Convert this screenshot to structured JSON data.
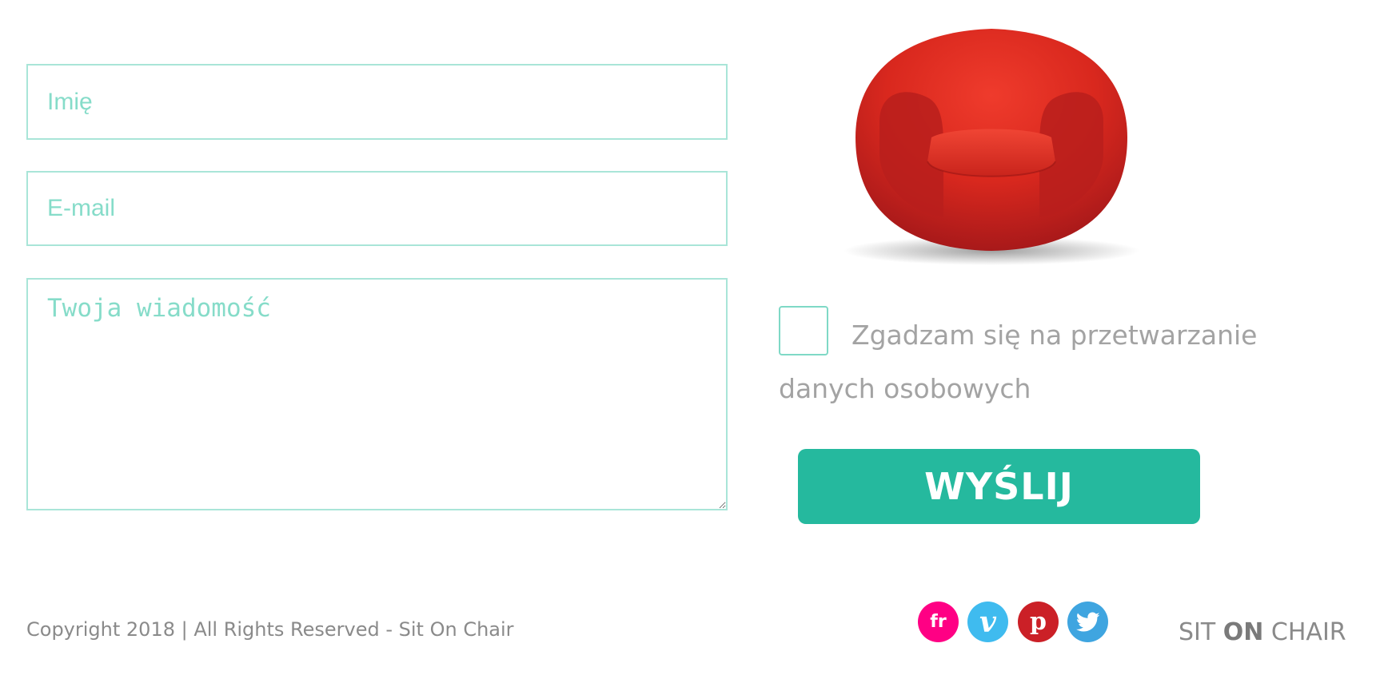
{
  "form": {
    "name_placeholder": "Imię",
    "email_placeholder": "E-mail",
    "message_placeholder": "Twoja wiadomość",
    "consent_label": "Zgadzam się na przetwarzanie danych osobowych",
    "consent_checked": false,
    "send_label": "WYŚLIJ"
  },
  "footer": {
    "copyright": "Copyright 2018 | All Rights Reserved - Sit On Chair",
    "logo_part1": "SIT ",
    "logo_part2": "ON",
    "logo_part3": " CHAIR"
  },
  "social": {
    "flickr": "fr",
    "vimeo": "v",
    "pinterest": "p"
  },
  "icons": [
    "chair-image",
    "flickr-icon",
    "vimeo-icon",
    "pinterest-icon",
    "twitter-icon"
  ],
  "colors": {
    "accent": "#25b99e",
    "field_border": "#a9e5d8",
    "placeholder": "#86dcc9",
    "text_gray": "#8a8a8a",
    "flickr": "#ff0084",
    "vimeo": "#3fbbef",
    "pinterest": "#cb2027",
    "twitter": "#3fa5e0"
  }
}
